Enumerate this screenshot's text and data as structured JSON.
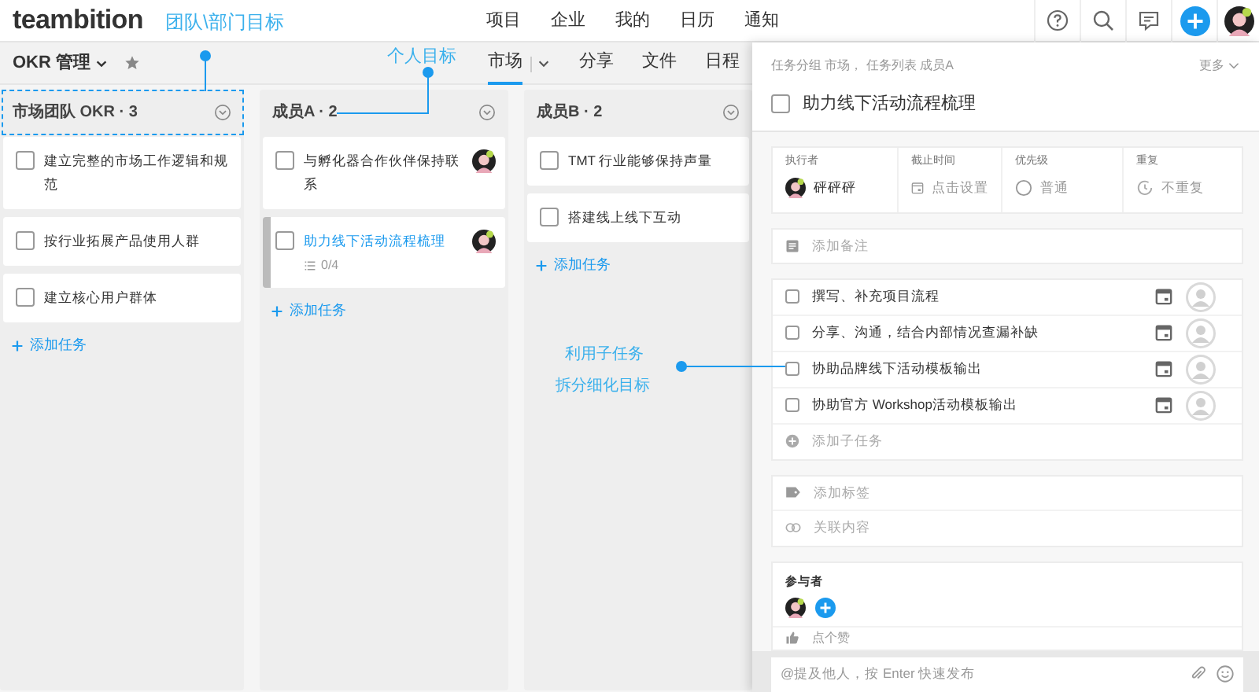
{
  "nav": {
    "logo": "teambition",
    "items": [
      "项目",
      "企业",
      "我的",
      "日历",
      "通知"
    ]
  },
  "project": {
    "name": "OKR 管理",
    "tabs": [
      {
        "label": "市场",
        "selected": true
      },
      {
        "label": "分享",
        "selected": false
      },
      {
        "label": "文件",
        "selected": false
      },
      {
        "label": "日程",
        "selected": false
      }
    ]
  },
  "columns": [
    {
      "title": "市场团队 OKR · 3",
      "add_label": "添加任务",
      "tasks": [
        {
          "title": "建立完整的市场工作逻辑和规范",
          "selected": false,
          "has_avatar": false
        },
        {
          "title": "按行业拓展产品使用人群",
          "selected": false,
          "has_avatar": false
        },
        {
          "title": "建立核心用户群体",
          "selected": false,
          "has_avatar": false
        }
      ]
    },
    {
      "title": "成员A · 2",
      "add_label": "添加任务",
      "tasks": [
        {
          "title": "与孵化器合作伙伴保持联系",
          "selected": false,
          "has_avatar": true
        },
        {
          "title": "助力线下活动流程梳理",
          "selected": true,
          "has_avatar": true,
          "subtasks": "0/4"
        }
      ]
    },
    {
      "title": "成员B · 2",
      "add_label": "添加任务",
      "tasks": [
        {
          "title": "TMT 行业能够保持声量",
          "selected": false,
          "has_avatar": false
        },
        {
          "title": "搭建线上线下互动",
          "selected": false,
          "has_avatar": false
        }
      ]
    }
  ],
  "detail": {
    "breadcrumb": "任务分组 市场， 任务列表 成员A",
    "more": "更多",
    "title": "助力线下活动流程梳理",
    "done": false,
    "fields": [
      {
        "kind": "assignee",
        "label": "执行者",
        "value": "砰砰砰"
      },
      {
        "kind": "date",
        "label": "截止时间",
        "value": "点击设置"
      },
      {
        "kind": "priority",
        "label": "优先级",
        "value": "普通"
      },
      {
        "kind": "repeat",
        "label": "重复",
        "value": "不重复"
      }
    ],
    "note_placeholder": "添加备注",
    "subtasks": [
      {
        "title": "撰写、补充项目流程",
        "checked": false
      },
      {
        "title": "分享、沟通，结合内部情况查漏补缺",
        "checked": false
      },
      {
        "title": "协助品牌线下活动模板输出",
        "checked": false
      },
      {
        "title": "协助官方 Workshop活动模板输出",
        "checked": false
      }
    ],
    "add_subtask": "添加子任务",
    "add_tag": "添加标签",
    "link": "关联内容",
    "participants_label": "参与者",
    "like": "点个赞",
    "comment_placeholder": "@提及他人，按 Enter 快速发布"
  },
  "annotations": [
    {
      "text": "团队\\部门目标"
    },
    {
      "text": "个人目标"
    },
    {
      "text": "利用子任务"
    },
    {
      "text": "拆分细化目标"
    }
  ]
}
